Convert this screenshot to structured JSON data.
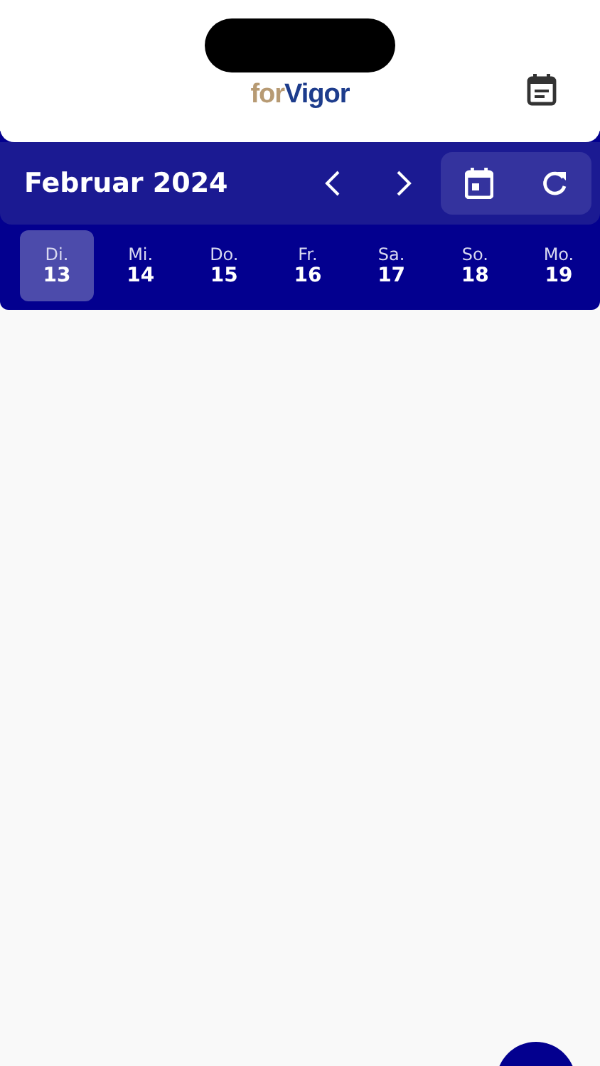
{
  "logo": {
    "prefix": "for",
    "name": "Vigor"
  },
  "header": {
    "title": "Februar 2024"
  },
  "days": [
    {
      "weekday": "Di.",
      "date": "13",
      "selected": true
    },
    {
      "weekday": "Mi.",
      "date": "14",
      "selected": false
    },
    {
      "weekday": "Do.",
      "date": "15",
      "selected": false
    },
    {
      "weekday": "Fr.",
      "date": "16",
      "selected": false
    },
    {
      "weekday": "Sa.",
      "date": "17",
      "selected": false
    },
    {
      "weekday": "So.",
      "date": "18",
      "selected": false
    },
    {
      "weekday": "Mo.",
      "date": "19",
      "selected": false
    }
  ]
}
